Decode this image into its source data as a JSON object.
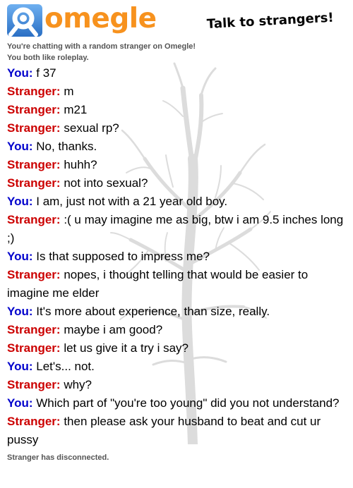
{
  "header": {
    "logo_text": "omegle",
    "tagline": "Talk to strangers!",
    "colors": {
      "logo_blue": "#3a80d1",
      "logo_orange": "#f7921e"
    }
  },
  "status_top": [
    "You're chatting with a random stranger on Omegle!",
    "You both like roleplay."
  ],
  "speakers": {
    "you": "You:",
    "stranger": "Stranger:"
  },
  "colors": {
    "you": "#0000cc",
    "stranger": "#cc0000",
    "status": "#555555"
  },
  "messages": [
    {
      "from": "you",
      "text": "f 37"
    },
    {
      "from": "stranger",
      "text": "m"
    },
    {
      "from": "stranger",
      "text": "m21"
    },
    {
      "from": "stranger",
      "text": "sexual rp?"
    },
    {
      "from": "you",
      "text": "No, thanks."
    },
    {
      "from": "stranger",
      "text": "huhh?"
    },
    {
      "from": "stranger",
      "text": "not into sexual?"
    },
    {
      "from": "you",
      "text": "I am, just not with a 21 year old boy."
    },
    {
      "from": "stranger",
      "text": ":( u may imagine me as big, btw i am 9.5 inches long ;)"
    },
    {
      "from": "you",
      "text": "Is that supposed to impress me?"
    },
    {
      "from": "stranger",
      "text": "nopes, i thought telling that would be easier to imagine me elder"
    },
    {
      "from": "you",
      "text": "It's more about experience, than size, really."
    },
    {
      "from": "stranger",
      "text": "maybe i am good?"
    },
    {
      "from": "stranger",
      "text": "let us give it a try i say?"
    },
    {
      "from": "you",
      "text": "Let's... not."
    },
    {
      "from": "stranger",
      "text": "why?"
    },
    {
      "from": "you",
      "text": "Which part of \"you're too young\" did you not understand?"
    },
    {
      "from": "stranger",
      "text": "then please ask your husband to beat and cut ur pussy"
    }
  ],
  "status_bottom": "Stranger has disconnected."
}
